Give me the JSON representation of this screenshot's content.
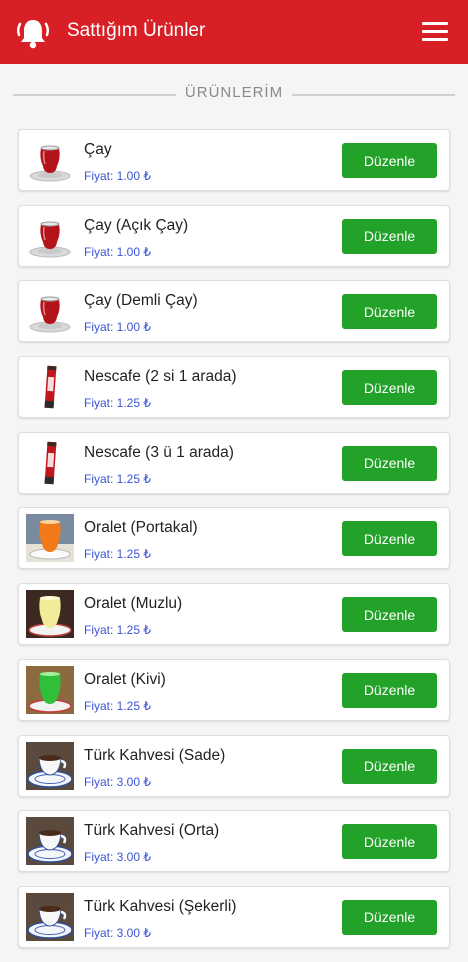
{
  "appbar": {
    "title": "Sattığım Ürünler",
    "color": "#d81f26",
    "left_icon": "bell-icon",
    "right_icon": "hamburger-menu-icon"
  },
  "section": {
    "title": "ÜRÜNLERİM"
  },
  "products": [
    {
      "name": "Çay",
      "price": "Fiyat: 1.00 ₺",
      "button": "Düzenle",
      "thumb": "tea"
    },
    {
      "name": "Çay (Açık Çay)",
      "price": "Fiyat: 1.00 ₺",
      "button": "Düzenle",
      "thumb": "tea"
    },
    {
      "name": "Çay (Demli Çay)",
      "price": "Fiyat: 1.00 ₺",
      "button": "Düzenle",
      "thumb": "tea"
    },
    {
      "name": "Nescafe (2 si 1 arada)",
      "price": "Fiyat: 1.25 ₺",
      "button": "Düzenle",
      "thumb": "nescafe"
    },
    {
      "name": "Nescafe (3 ü 1 arada)",
      "price": "Fiyat: 1.25 ₺",
      "button": "Düzenle",
      "thumb": "nescafe"
    },
    {
      "name": "Oralet (Portakal)",
      "price": "Fiyat: 1.25 ₺",
      "button": "Düzenle",
      "thumb": "oralet-orange"
    },
    {
      "name": "Oralet (Muzlu)",
      "price": "Fiyat: 1.25 ₺",
      "button": "Düzenle",
      "thumb": "oralet-banana"
    },
    {
      "name": "Oralet (Kivi)",
      "price": "Fiyat: 1.25 ₺",
      "button": "Düzenle",
      "thumb": "oralet-kiwi"
    },
    {
      "name": "Türk Kahvesi (Sade)",
      "price": "Fiyat: 3.00 ₺",
      "button": "Düzenle",
      "thumb": "turkish-coffee"
    },
    {
      "name": "Türk Kahvesi (Orta)",
      "price": "Fiyat: 3.00 ₺",
      "button": "Düzenle",
      "thumb": "turkish-coffee"
    },
    {
      "name": "Türk Kahvesi (Şekerli)",
      "price": "Fiyat: 3.00 ₺",
      "button": "Düzenle",
      "thumb": "turkish-coffee"
    }
  ],
  "colors": {
    "button": "#23a229",
    "price": "#3b55d6",
    "divider": "#d0d0d0"
  }
}
